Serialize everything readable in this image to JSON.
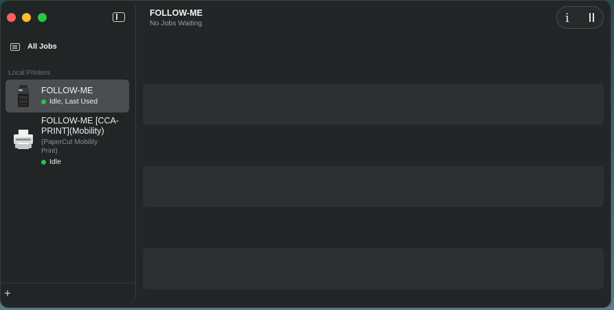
{
  "window": {
    "traffic_lights": {
      "close": "#fe5f57",
      "minimize": "#febc2e",
      "zoom": "#28c840"
    }
  },
  "sidebar": {
    "all_jobs_label": "All Jobs",
    "section_label": "Local Printers",
    "printers": [
      {
        "name": "FOLLOW-ME",
        "status": "Idle, Last Used",
        "status_color": "#2ac545",
        "icon": "copier-icon",
        "selected": true
      },
      {
        "name_line1": "FOLLOW-ME [CCA-",
        "name_line2": "PRINT](Mobility)",
        "sub_line1": "(PaperCut Mobility",
        "sub_line2": "Print)",
        "status": "Idle",
        "status_color": "#2ac545",
        "icon": "printer-icon",
        "selected": false
      }
    ],
    "add_label": "+"
  },
  "header": {
    "title": "FOLLOW-ME",
    "subtitle": "No Jobs Waiting",
    "info_label": "i"
  }
}
